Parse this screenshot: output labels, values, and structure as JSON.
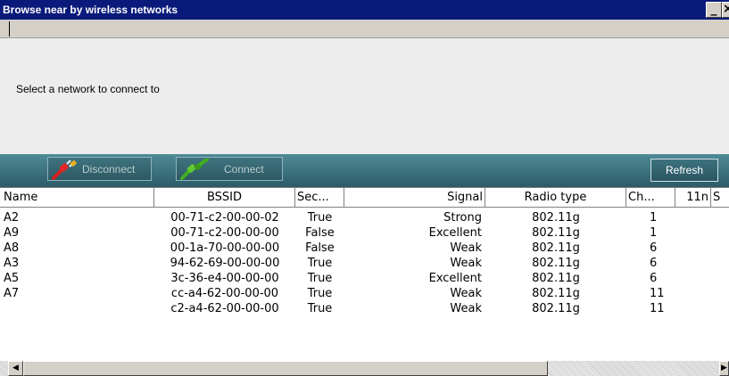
{
  "window": {
    "title": "Browse near by wireless networks",
    "minimize_glyph": "_",
    "close_glyph": "×"
  },
  "instruction": "Select a network to connect to",
  "toolbar": {
    "disconnect_label": "Disconnect",
    "connect_label": "Connect",
    "refresh_label": "Refresh",
    "disconnect_icon": "plug-disconnect-icon",
    "connect_icon": "plug-connect-icon",
    "toolbar_color": "#2f6370"
  },
  "columns": [
    "Name",
    "BSSID",
    "Sec...",
    "Signal",
    "Radio type",
    "Ch...",
    "11n",
    "S"
  ],
  "networks": [
    {
      "name": "A2",
      "bssid": "00-71-c2-00-00-02",
      "security": "True",
      "signal": "Strong",
      "radio": "802.11g",
      "channel": "1",
      "n11": ""
    },
    {
      "name": "A9",
      "bssid": "00-71-c2-00-00-00",
      "security": "False",
      "signal": "Excellent",
      "radio": "802.11g",
      "channel": "1",
      "n11": ""
    },
    {
      "name": "A8",
      "bssid": "00-1a-70-00-00-00",
      "security": "False",
      "signal": "Weak",
      "radio": "802.11g",
      "channel": "6",
      "n11": ""
    },
    {
      "name": "A3",
      "bssid": "94-62-69-00-00-00",
      "security": "True",
      "signal": "Weak",
      "radio": "802.11g",
      "channel": "6",
      "n11": ""
    },
    {
      "name": "A5",
      "bssid": "3c-36-e4-00-00-00",
      "security": "True",
      "signal": "Excellent",
      "radio": "802.11g",
      "channel": "6",
      "n11": ""
    },
    {
      "name": "A7",
      "bssid": "cc-a4-62-00-00-00",
      "security": "True",
      "signal": "Weak",
      "radio": "802.11g",
      "channel": "11",
      "n11": ""
    },
    {
      "name": "",
      "bssid": "c2-a4-62-00-00-00",
      "security": "True",
      "signal": "Weak",
      "radio": "802.11g",
      "channel": "11",
      "n11": ""
    }
  ],
  "scrollbar": {
    "left_glyph": "◀",
    "right_glyph": "▶"
  }
}
